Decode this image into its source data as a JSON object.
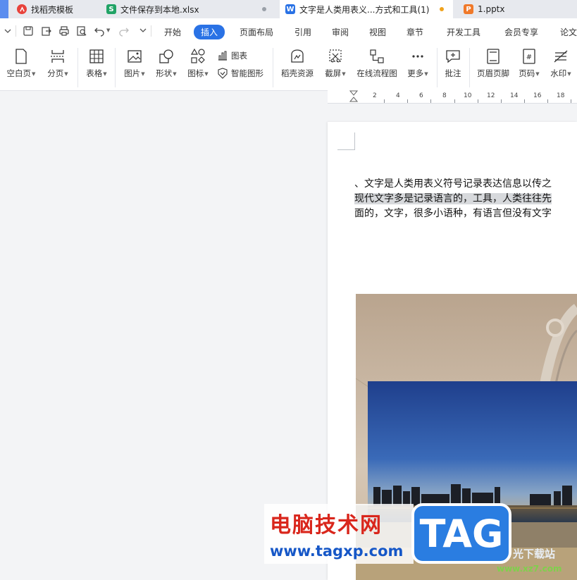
{
  "tabs": [
    {
      "label": "找稻壳模板",
      "badge": "",
      "color": "#e8423b"
    },
    {
      "label": "文件保存到本地.xlsx",
      "badge": "S",
      "color": "#21a366"
    },
    {
      "label": "文字是人类用表义...方式和工具(1)",
      "badge": "W",
      "color": "#2a72e5"
    },
    {
      "label": "1.pptx",
      "badge": "P",
      "color": "#f0792a"
    }
  ],
  "menu": [
    "开始",
    "插入",
    "页面布局",
    "引用",
    "审阅",
    "视图",
    "章节",
    "开发工具",
    "会员专享",
    "论文"
  ],
  "active_menu": "插入",
  "ribbon": {
    "blank_page": "空白页",
    "page_break": "分页",
    "table": "表格",
    "picture": "图片",
    "shape": "形状",
    "icons": "图标",
    "chart": "图表",
    "smart_art": "智能图形",
    "daoke": "稻壳资源",
    "screenshot": "截屏",
    "flowchart": "在线流程图",
    "more": "更多",
    "comment": "批注",
    "header_footer": "页眉页脚",
    "page_number": "页码",
    "watermark": "水印"
  },
  "ruler_ticks": [
    "2",
    "4",
    "6",
    "8",
    "10",
    "12",
    "14",
    "16",
    "18"
  ],
  "doc": {
    "line1": "、文字是人类用表义符号记录表达信息以传之",
    "line2_highlight": "现代文字多是记录语言的，工具，人类往往先",
    "line3": "面的，文字，很多小语种，有语言但没有文字"
  },
  "watermark": {
    "site_name": "电脑技术网",
    "site_url": "www.tagxp.com",
    "tag": "TAG",
    "xz": "光下载站",
    "xz_url": "www.xz7.com"
  },
  "colors": {
    "accent": "#2a72e5",
    "ribbon_bg": "#ffffff",
    "canvas": "#f3f4f6"
  }
}
